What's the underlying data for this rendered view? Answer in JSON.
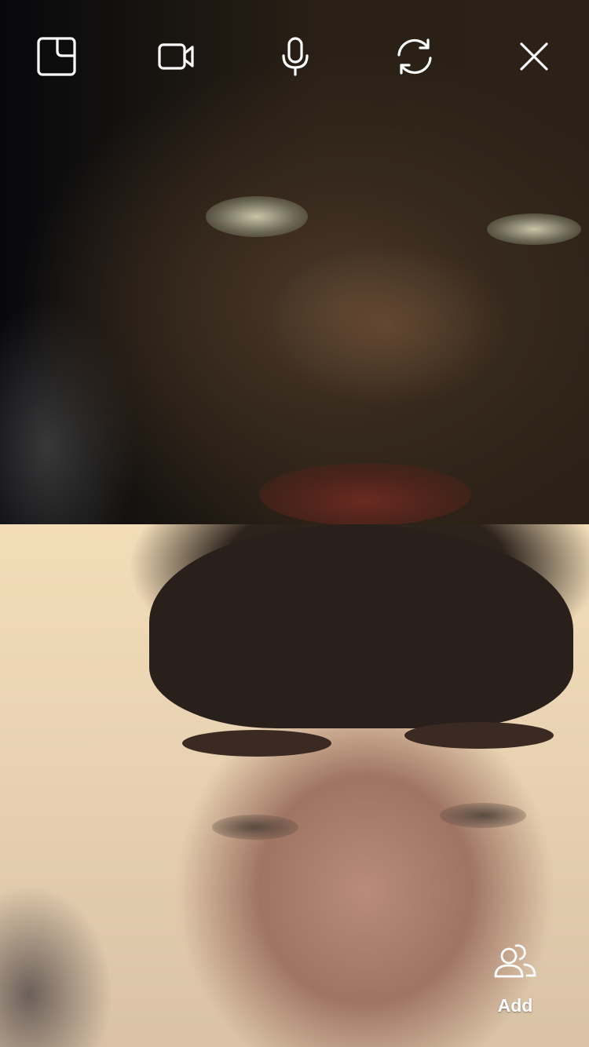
{
  "call": {
    "toolbar": {
      "buttons": [
        {
          "name": "minimize",
          "icon": "picture-in-picture-icon"
        },
        {
          "name": "camera",
          "icon": "video-camera-icon"
        },
        {
          "name": "microphone",
          "icon": "microphone-icon"
        },
        {
          "name": "flip-camera",
          "icon": "camera-switch-icon"
        },
        {
          "name": "end-call",
          "icon": "close-icon"
        }
      ]
    },
    "add_participants": {
      "label": "Add",
      "icon": "add-people-icon"
    },
    "colors": {
      "icon": "#ffffff",
      "background": "#000000"
    }
  }
}
